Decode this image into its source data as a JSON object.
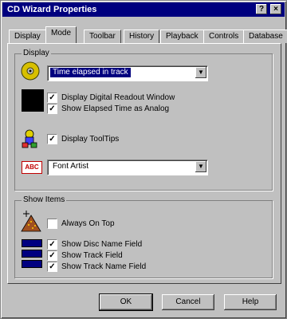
{
  "title": "CD Wizard Properties",
  "titlebar": {
    "help": "?",
    "close": "×"
  },
  "tabs": [
    "Display",
    "Mode",
    "Toolbar",
    "History",
    "Playback",
    "Controls",
    "Database"
  ],
  "active_tab": 1,
  "display_group": {
    "legend": "Display",
    "mode_combo": "Time elapsed in track",
    "checks": [
      {
        "label": "Display Digital Readout Window",
        "checked": true
      },
      {
        "label": "Show Elapsed Time as Analog",
        "checked": true
      }
    ],
    "tooltips_label": "Display ToolTips",
    "tooltips_checked": true,
    "font_combo": "Font Artist",
    "font_badge": "ABC"
  },
  "show_group": {
    "legend": "Show Items",
    "always_on_top": {
      "label": "Always On Top",
      "checked": false
    },
    "checks": [
      {
        "label": "Show Disc Name Field",
        "checked": true
      },
      {
        "label": "Show Track Field",
        "checked": true
      },
      {
        "label": "Show Track Name Field",
        "checked": true
      }
    ]
  },
  "buttons": {
    "ok": "OK",
    "cancel": "Cancel",
    "help": "Help"
  }
}
